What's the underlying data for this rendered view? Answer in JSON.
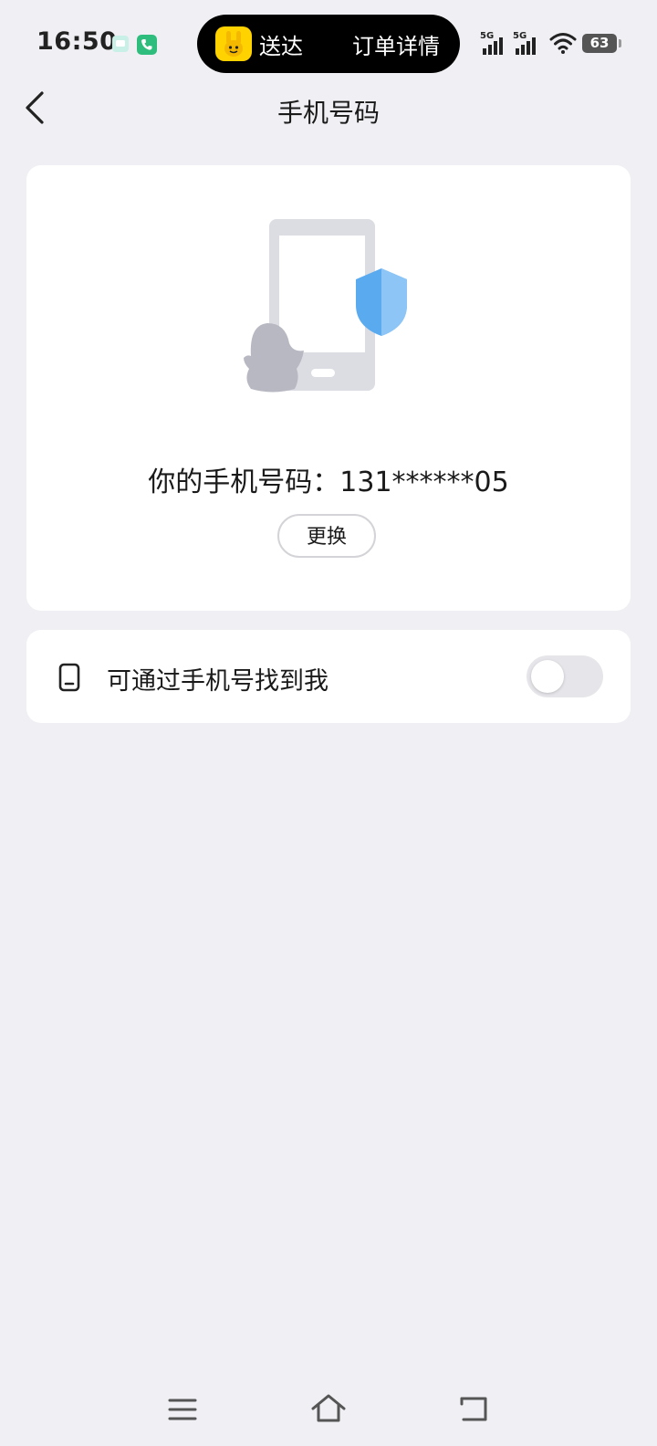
{
  "status_bar": {
    "time": "16:50",
    "signal_1": "5G",
    "signal_2": "5G",
    "battery": "63"
  },
  "live_activity": {
    "left_text": "送达",
    "right_text": "订单详情",
    "app_icon_color": "#ffd200"
  },
  "header": {
    "title": "手机号码"
  },
  "phone_card": {
    "label": "你的手机号码：",
    "number": "131******05",
    "change_label": "更换"
  },
  "find_setting": {
    "label": "可通过手机号找到我",
    "enabled": false
  },
  "colors": {
    "background": "#f0f0f4",
    "card": "#ffffff",
    "shield": "#5aaaf0",
    "toggle_off": "#e6e6ea"
  }
}
